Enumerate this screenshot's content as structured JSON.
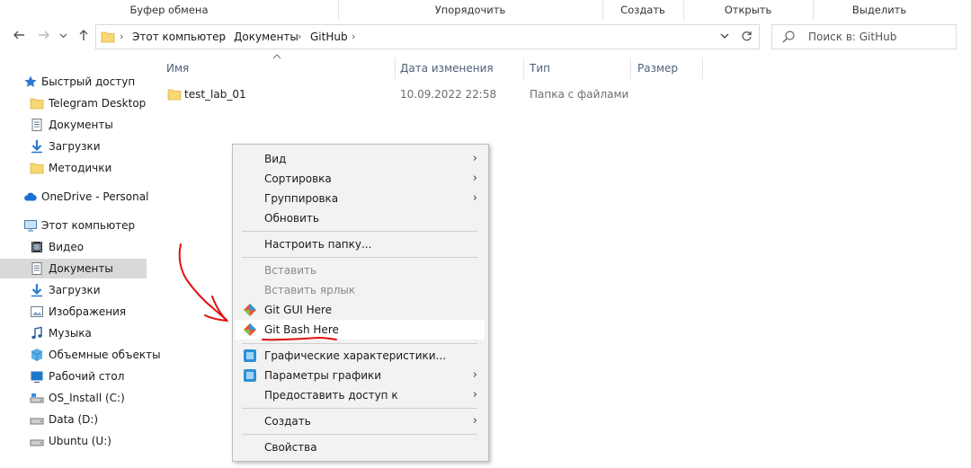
{
  "ribbon": {
    "groups": [
      "Буфер обмена",
      "Упорядочить",
      "Создать",
      "Открыть",
      "Выделить"
    ]
  },
  "address": {
    "crumbs": [
      "Этот компьютер",
      "Документы",
      "GitHub"
    ],
    "search_placeholder": "Поиск в: GitHub"
  },
  "nav": {
    "items": [
      {
        "label": "Быстрый доступ",
        "icon": "star-icon"
      },
      {
        "label": "Telegram Desktop",
        "icon": "folder-icon"
      },
      {
        "label": "Документы",
        "icon": "documents-icon"
      },
      {
        "label": "Загрузки",
        "icon": "download-icon"
      },
      {
        "label": "Методички",
        "icon": "folder-icon"
      },
      {
        "label": "OneDrive - Personal",
        "icon": "cloud-icon"
      },
      {
        "label": "Этот компьютер",
        "icon": "computer-icon"
      },
      {
        "label": "Видео",
        "icon": "video-icon"
      },
      {
        "label": "Документы",
        "icon": "documents-icon",
        "selected": true
      },
      {
        "label": "Загрузки",
        "icon": "download-icon"
      },
      {
        "label": "Изображения",
        "icon": "pictures-icon"
      },
      {
        "label": "Музыка",
        "icon": "music-icon"
      },
      {
        "label": "Объемные объекты",
        "icon": "3d-objects-icon"
      },
      {
        "label": "Рабочий стол",
        "icon": "desktop-icon"
      },
      {
        "label": "OS_Install (C:)",
        "icon": "drive-icon"
      },
      {
        "label": "Data (D:)",
        "icon": "drive-icon"
      },
      {
        "label": "Ubuntu (U:)",
        "icon": "drive-icon"
      }
    ]
  },
  "columns": {
    "name": "Имя",
    "date": "Дата изменения",
    "type": "Тип",
    "size": "Размер"
  },
  "files": [
    {
      "name": "test_lab_01",
      "date": "10.09.2022 22:58",
      "type": "Папка с файлами",
      "size": ""
    }
  ],
  "context_menu": {
    "view": "Вид",
    "sort": "Сортировка",
    "group": "Группировка",
    "refresh": "Обновить",
    "customize": "Настроить папку...",
    "paste": "Вставить",
    "paste_shortcut": "Вставить ярлык",
    "git_gui": "Git GUI Here",
    "git_bash": "Git Bash Here",
    "graphics_props": "Графические характеристики...",
    "graphics_options": "Параметры графики",
    "share": "Предоставить доступ к",
    "new": "Создать",
    "properties": "Свойства"
  },
  "colors": {
    "accent": "#0078d7",
    "selected_bg": "#d9d9d9",
    "menu_bg": "#f2f2f2",
    "annotation": "#e01010"
  }
}
